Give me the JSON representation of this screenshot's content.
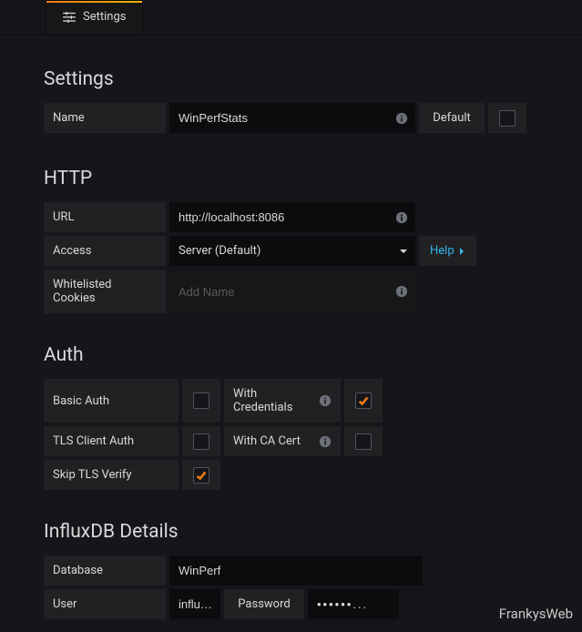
{
  "tab": {
    "label": "Settings"
  },
  "sections": {
    "settings": {
      "title": "Settings",
      "nameLabel": "Name",
      "nameValue": "WinPerfStats",
      "defaultLabel": "Default",
      "defaultChecked": false
    },
    "http": {
      "title": "HTTP",
      "urlLabel": "URL",
      "urlValue": "http://localhost:8086",
      "accessLabel": "Access",
      "accessValue": "Server (Default)",
      "helpLabel": "Help",
      "cookiesLabel": "Whitelisted Cookies",
      "cookiesPlaceholder": "Add Name"
    },
    "auth": {
      "title": "Auth",
      "basicAuth": {
        "label": "Basic Auth",
        "checked": false
      },
      "withCredentials": {
        "label": "With Credentials",
        "checked": true
      },
      "tlsClientAuth": {
        "label": "TLS Client Auth",
        "checked": false
      },
      "withCaCert": {
        "label": "With CA Cert",
        "checked": false
      },
      "skipTlsVerify": {
        "label": "Skip TLS Verify",
        "checked": true
      }
    },
    "influx": {
      "title": "InfluxDB Details",
      "databaseLabel": "Database",
      "databaseValue": "WinPerf",
      "userLabel": "User",
      "userValue": "influx...",
      "passwordLabel": "Password",
      "passwordValue": "••••••..."
    }
  },
  "watermark": "FrankysWeb"
}
